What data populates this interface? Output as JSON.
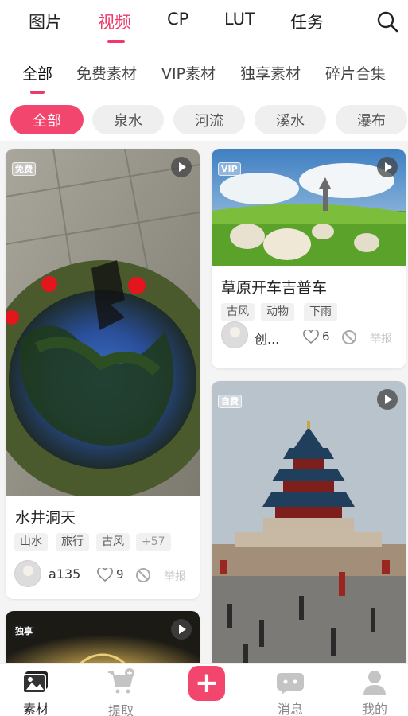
{
  "top_tabs": [
    {
      "label": "图片"
    },
    {
      "label": "视频",
      "active": true
    },
    {
      "label": "CP"
    },
    {
      "label": "LUT"
    },
    {
      "label": "任务"
    }
  ],
  "sub_tabs": [
    {
      "label": "全部",
      "active": true
    },
    {
      "label": "免费素材"
    },
    {
      "label": "VIP素材"
    },
    {
      "label": "独享素材"
    },
    {
      "label": "碎片合集"
    }
  ],
  "chips": [
    {
      "label": "全部",
      "active": true
    },
    {
      "label": "泉水"
    },
    {
      "label": "河流"
    },
    {
      "label": "溪水"
    },
    {
      "label": "瀑布"
    }
  ],
  "cards": [
    {
      "badge": "免费",
      "title": "水井洞天",
      "tags": [
        "山水",
        "旅行",
        "古风"
      ],
      "more_tags": "+57",
      "author": "a135",
      "likes": "9",
      "report": "举报"
    },
    {
      "badge": "VIP",
      "title": "草原开车吉普车",
      "tags": [
        "古风",
        "动物",
        "下雨"
      ],
      "author": "创...",
      "likes": "6",
      "report": "举报"
    },
    {
      "badge": "自费"
    },
    {
      "badge": "独享"
    }
  ],
  "bottom_nav": {
    "items": [
      "素材",
      "提取",
      "消息",
      "我的"
    ],
    "accent_color": "#f2466e"
  }
}
